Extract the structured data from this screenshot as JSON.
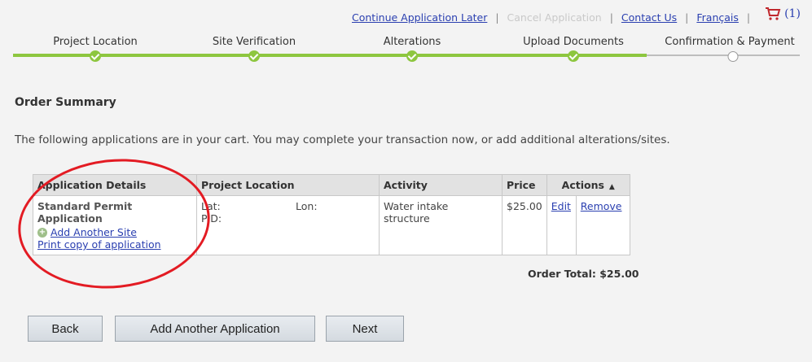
{
  "header": {
    "continue_later": "Continue Application Later",
    "cancel": "Cancel Application",
    "contact": "Contact Us",
    "language": "Français",
    "cart_count": "(1)",
    "separator": "|"
  },
  "steps": [
    {
      "label": "Project Location",
      "status": "done"
    },
    {
      "label": "Site Verification",
      "status": "done"
    },
    {
      "label": "Alterations",
      "status": "done"
    },
    {
      "label": "Upload Documents",
      "status": "done"
    },
    {
      "label": "Confirmation & Payment",
      "status": "todo"
    }
  ],
  "summary": {
    "title": "Order Summary",
    "intro": "The following applications are in your cart. You may complete your transaction now, or add additional alterations/sites."
  },
  "table": {
    "headers": {
      "app_details": "Application Details",
      "location": "Project Location",
      "activity": "Activity",
      "price": "Price",
      "actions": "Actions"
    },
    "row": {
      "app_name": "Standard Permit Application",
      "add_site": "Add Another Site",
      "print": "Print copy of application",
      "lat": "Lat:",
      "lon": "Lon:",
      "pid": "PID:",
      "activity": "Water intake structure",
      "price": "$25.00",
      "edit": "Edit",
      "remove": "Remove"
    }
  },
  "order_total": "Order Total: $25.00",
  "buttons": {
    "back": "Back",
    "add_application": "Add Another Application",
    "next": "Next"
  },
  "colors": {
    "progress_done": "#8dc63f",
    "link": "#2a3fb0",
    "annotation": "#e31b23"
  }
}
